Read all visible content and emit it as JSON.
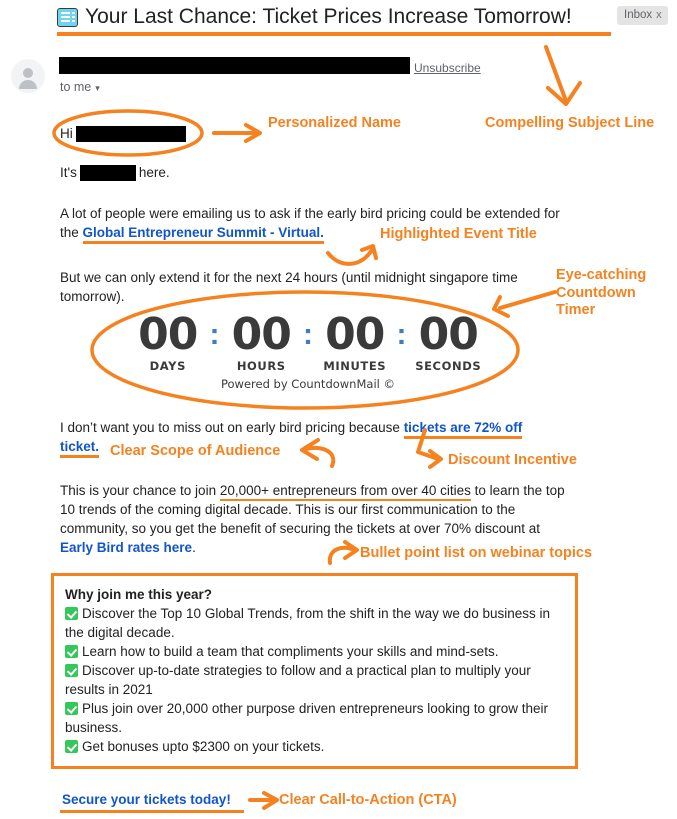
{
  "colors": {
    "accent_orange": "#F5821F",
    "link_blue": "#1155CC",
    "countdown_digit": "#3A3A3A",
    "countdown_colon": "#3D7EBF",
    "check_green": "#34C759",
    "body_text": "#222222",
    "meta_gray": "#5F6368"
  },
  "header": {
    "subject_icon": "ticket-card-icon",
    "subject": "Your Last Chance: Ticket Prices Increase Tomorrow!",
    "label_badge": "Inbox",
    "label_remove": "x"
  },
  "sender": {
    "avatar": "generic-avatar-icon",
    "sender_name_redacted": "",
    "unsubscribe_label": "Unsubscribe",
    "recipient_label": "to me",
    "recipient_caret": "▾"
  },
  "email_body": {
    "greeting_prefix": "Hi",
    "greeting_name_redacted": "",
    "intro_prefix": "It's",
    "intro_name_redacted": "",
    "intro_suffix": "here.",
    "para1_before_link": "A lot of people were emailing us to ask if the early bird pricing could be extended for the ",
    "para1_link": "Global Entrepreneur Summit - Virtual.",
    "para2": "But we can only extend it for the next 24 hours (until midnight singapore time tomorrow).",
    "para3_before_link": "I don’t want you to miss out on early bird pricing because ",
    "para3_link": "tickets are 72% off ticket.",
    "para4_part1": "This is your chance to join ",
    "para4_highlight": "20,000+ entrepreneurs from over 40 cities",
    "para4_part2": " to learn the top 10 trends of the coming digital decade. This is our first communication to the community, so you get the benefit of securing the tickets at over 70% discount at ",
    "para4_link": "Early Bird rates here",
    "para4_end": "."
  },
  "countdown": {
    "units": [
      {
        "value": "00",
        "label": "DAYS"
      },
      {
        "value": "00",
        "label": "HOURS"
      },
      {
        "value": "00",
        "label": "MINUTES"
      },
      {
        "value": "00",
        "label": "SECONDS"
      }
    ],
    "separator": ":",
    "powered_by": "Powered by CountdownMail ©"
  },
  "benefits": {
    "title": "Why join me this year?",
    "items": [
      "Discover the Top 10 Global Trends, from the shift in the way we do business in the digital decade.",
      "Learn how to build a team that compliments your skills and mind-sets.",
      "Discover up-to-date strategies to follow and a practical plan to multiply your results in 2021",
      "Plus join over 20,000 other purpose driven entrepreneurs looking to grow their business.",
      "Get bonuses upto $2300 on your tickets."
    ]
  },
  "cta": {
    "label": "Secure your tickets today!"
  },
  "annotations": [
    {
      "id": "personalized-name",
      "text": "Personalized Name"
    },
    {
      "id": "compelling-subject-line",
      "text": "Compelling Subject Line"
    },
    {
      "id": "highlighted-event-title",
      "text": "Highlighted Event Title"
    },
    {
      "id": "eye-catching-countdown-timer",
      "text": "Eye-catching Countdown Timer"
    },
    {
      "id": "clear-scope-of-audience",
      "text": "Clear Scope of Audience"
    },
    {
      "id": "discount-incentive",
      "text": "Discount Incentive"
    },
    {
      "id": "bullet-point-list",
      "text": "Bullet point list on webinar topics"
    },
    {
      "id": "clear-call-to-action",
      "text": "Clear Call-to-Action (CTA)"
    }
  ]
}
